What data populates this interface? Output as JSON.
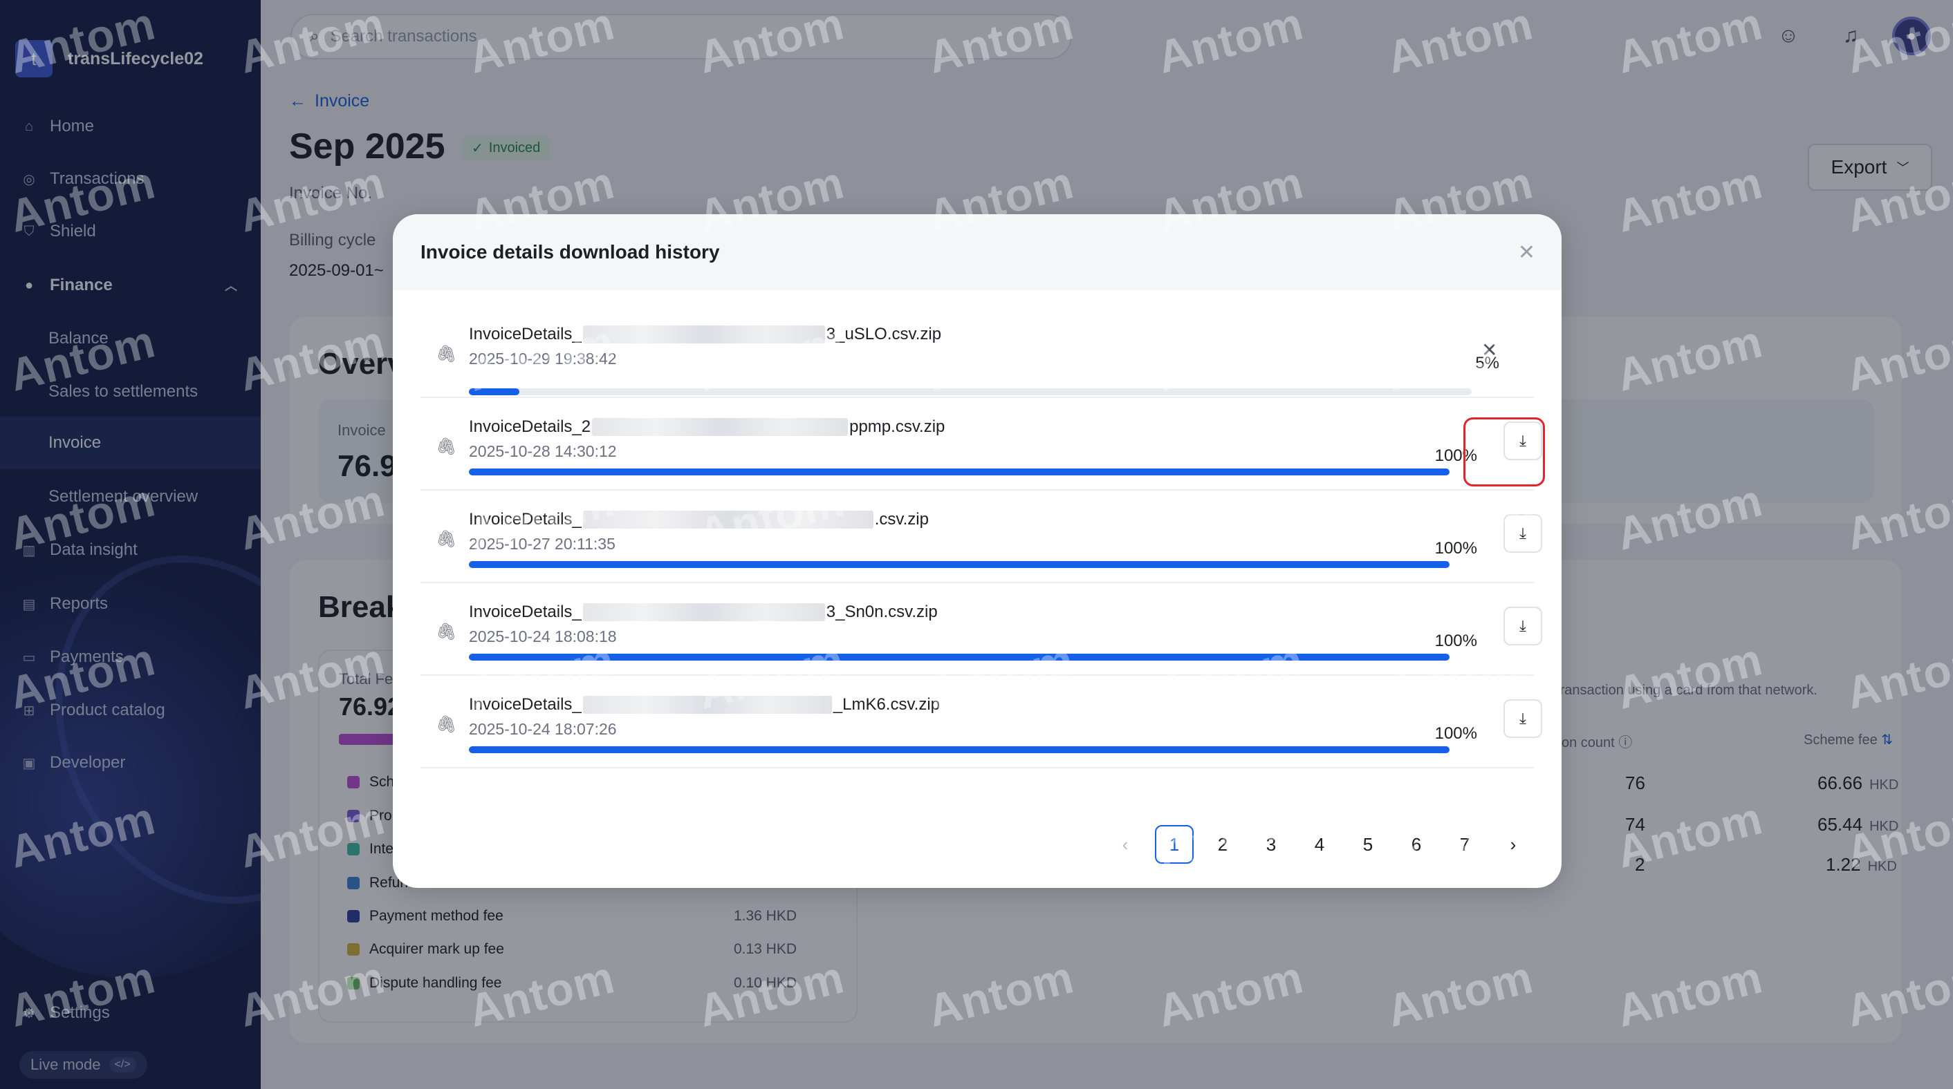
{
  "app": {
    "workspace_name": "transLifecycle02",
    "brand_initial": "t"
  },
  "sidebar": {
    "items": [
      {
        "label": "Home",
        "icon": "home-icon"
      },
      {
        "label": "Transactions",
        "icon": "transactions-icon"
      },
      {
        "label": "Shield",
        "icon": "shield-icon"
      },
      {
        "label": "Finance",
        "icon": "finance-icon"
      },
      {
        "label": "Balance"
      },
      {
        "label": "Sales to settlements"
      },
      {
        "label": "Invoice"
      },
      {
        "label": "Settlement overview"
      },
      {
        "label": "Data insight",
        "icon": "chart-icon"
      },
      {
        "label": "Reports",
        "icon": "reports-icon"
      },
      {
        "label": "Payments",
        "icon": "payments-icon"
      },
      {
        "label": "Product catalog",
        "icon": "catalog-icon"
      },
      {
        "label": "Developer",
        "icon": "developer-icon"
      },
      {
        "label": "Settings",
        "icon": "settings-icon"
      }
    ],
    "live_mode_label": "Live mode",
    "live_mode_code": "</>"
  },
  "topbar": {
    "search_placeholder": "Search transactions"
  },
  "page": {
    "back_label": "Invoice",
    "title": "Sep 2025",
    "status": "Invoiced",
    "invoice_no_label": "Invoice No.",
    "billing_cycle_label": "Billing cycle",
    "billing_cycle_value": "2025-09-01~",
    "export_label": "Export",
    "overview_title": "Overv",
    "overview_sub_label": "Invoice",
    "overview_amount": "76.9",
    "breakdown_title": "Break",
    "total_fee_label": "Total Fe",
    "total_fee_value": "76.92",
    "breakdown_items": [
      {
        "label": "Sch",
        "value": "",
        "color": "#c04fd6"
      },
      {
        "label": "Pro",
        "value": "",
        "color": "#7b5cd6"
      },
      {
        "label": "Inte",
        "value": "",
        "color": "#3ebfa6"
      },
      {
        "label": "Refun",
        "value": "",
        "color": "#3a84d6"
      },
      {
        "label": "Payment method fee",
        "value": "1.36 HKD",
        "color": "#2d3e9a"
      },
      {
        "label": "Acquirer mark up fee",
        "value": "0.13 HKD",
        "color": "#d9b43a"
      },
      {
        "label": "Dispute handling fee",
        "value": "0.10 HKD",
        "color": "#6cc06a"
      }
    ],
    "network_note": "transaction using a card from that network.",
    "col_count_label": "on count",
    "col_scheme_fee_label": "Scheme fee",
    "table_rows": [
      {
        "count": "76",
        "fee": "66.66",
        "currency": "HKD"
      },
      {
        "count": "74",
        "fee": "65.44",
        "currency": "HKD"
      },
      {
        "count": "2",
        "fee": "1.22",
        "currency": "HKD"
      }
    ]
  },
  "modal": {
    "title": "Invoice details download history",
    "files": [
      {
        "name_prefix": "InvoiceDetails_",
        "name_suffix": "3_uSLO.csv.zip",
        "time": "2025-10-29 19:38:42",
        "progress_label": "5%",
        "progress": 0.05,
        "state": "downloading"
      },
      {
        "name_prefix": "InvoiceDetails_2",
        "name_suffix": "ppmp.csv.zip",
        "time": "2025-10-28 14:30:12",
        "progress_label": "100%",
        "progress": 1.0,
        "state": "done"
      },
      {
        "name_prefix": "InvoiceDetails_",
        "name_suffix": ".csv.zip",
        "time": "2025-10-27 20:11:35",
        "progress_label": "100%",
        "progress": 1.0,
        "state": "done"
      },
      {
        "name_prefix": "InvoiceDetails_",
        "name_suffix": "3_Sn0n.csv.zip",
        "time": "2025-10-24 18:08:18",
        "progress_label": "100%",
        "progress": 1.0,
        "state": "done"
      },
      {
        "name_prefix": "InvoiceDetails_",
        "name_suffix": "_LmK6.csv.zip",
        "time": "2025-10-24 18:07:26",
        "progress_label": "100%",
        "progress": 1.0,
        "state": "done"
      }
    ],
    "pagination": {
      "pages": [
        "1",
        "2",
        "3",
        "4",
        "5",
        "6",
        "7"
      ],
      "current": "1"
    }
  },
  "watermark": "Antom",
  "colors": {
    "accent": "#1660e8",
    "sidebar_bg": "#141e45",
    "highlight": "#e0262c",
    "status_green": "#1f8a44"
  }
}
